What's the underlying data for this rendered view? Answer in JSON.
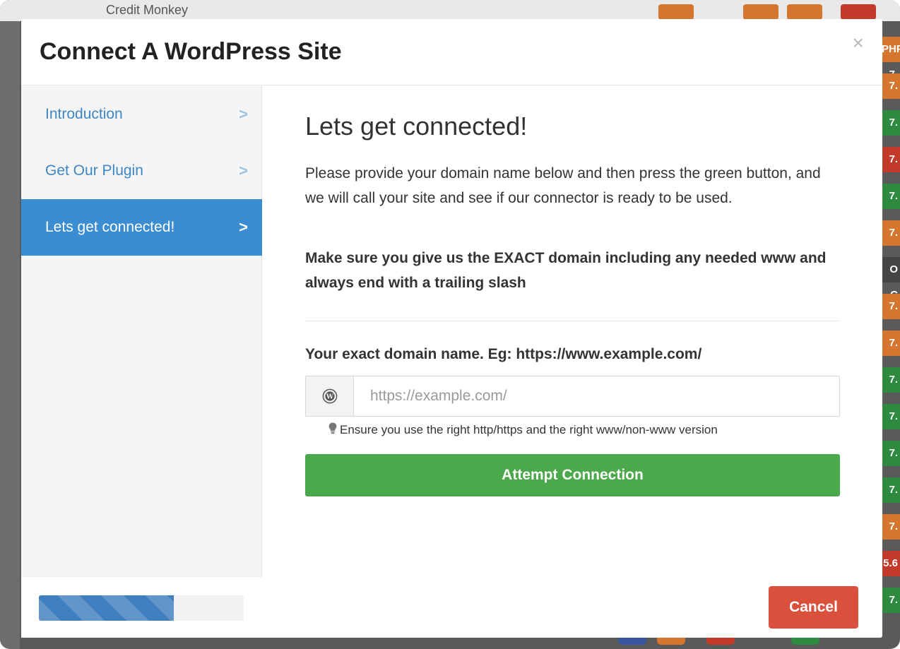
{
  "background": {
    "app_name": "Credit Monkey",
    "badges": [
      "PHP 7.",
      "7.",
      "7.",
      "7.",
      "7.",
      "7.",
      "O C",
      "7.",
      "7.",
      "7.",
      "7.",
      "7.",
      "7.",
      "7.",
      "5.6",
      "7."
    ],
    "badge_colors": [
      "#d4762e",
      "#d4762e",
      "#2d8a3e",
      "#c23b2a",
      "#2d8a3e",
      "#d4762e",
      "#444444",
      "#d4762e",
      "#d4762e",
      "#2d8a3e",
      "#2d8a3e",
      "#2d8a3e",
      "#2d8a3e",
      "#d4762e",
      "#c23b2a",
      "#2d8a3e"
    ]
  },
  "modal": {
    "title": "Connect A WordPress Site",
    "close_label": "×"
  },
  "sidebar": {
    "items": [
      {
        "label": "Introduction",
        "chevron": ">",
        "active": false
      },
      {
        "label": "Get Our Plugin",
        "chevron": ">",
        "active": false
      },
      {
        "label": "Lets get connected!",
        "chevron": ">",
        "active": true
      }
    ],
    "progress_percent": 66
  },
  "content": {
    "heading": "Lets get connected!",
    "paragraph": "Please provide your domain name below and then press the green button, and we will call your site and see if our connector is ready to be used.",
    "warning": "Make sure you give us the EXACT domain including any needed www and always end with a trailing slash",
    "field_label": "Your exact domain name. Eg: https://www.example.com/",
    "input_value": "",
    "input_placeholder": "https://example.com/",
    "hint": "Ensure you use the right http/https and the right www/non-www version",
    "attempt_button": "Attempt Connection"
  },
  "footer": {
    "cancel_button": "Cancel"
  },
  "colors": {
    "primary_blue": "#3a8dd1",
    "success_green": "#4ba84b",
    "danger_red": "#d9503c"
  },
  "icons": {
    "input_addon": "wordpress-icon",
    "hint": "lightbulb-icon",
    "close": "close-icon",
    "nav": "chevron-right-icon"
  }
}
